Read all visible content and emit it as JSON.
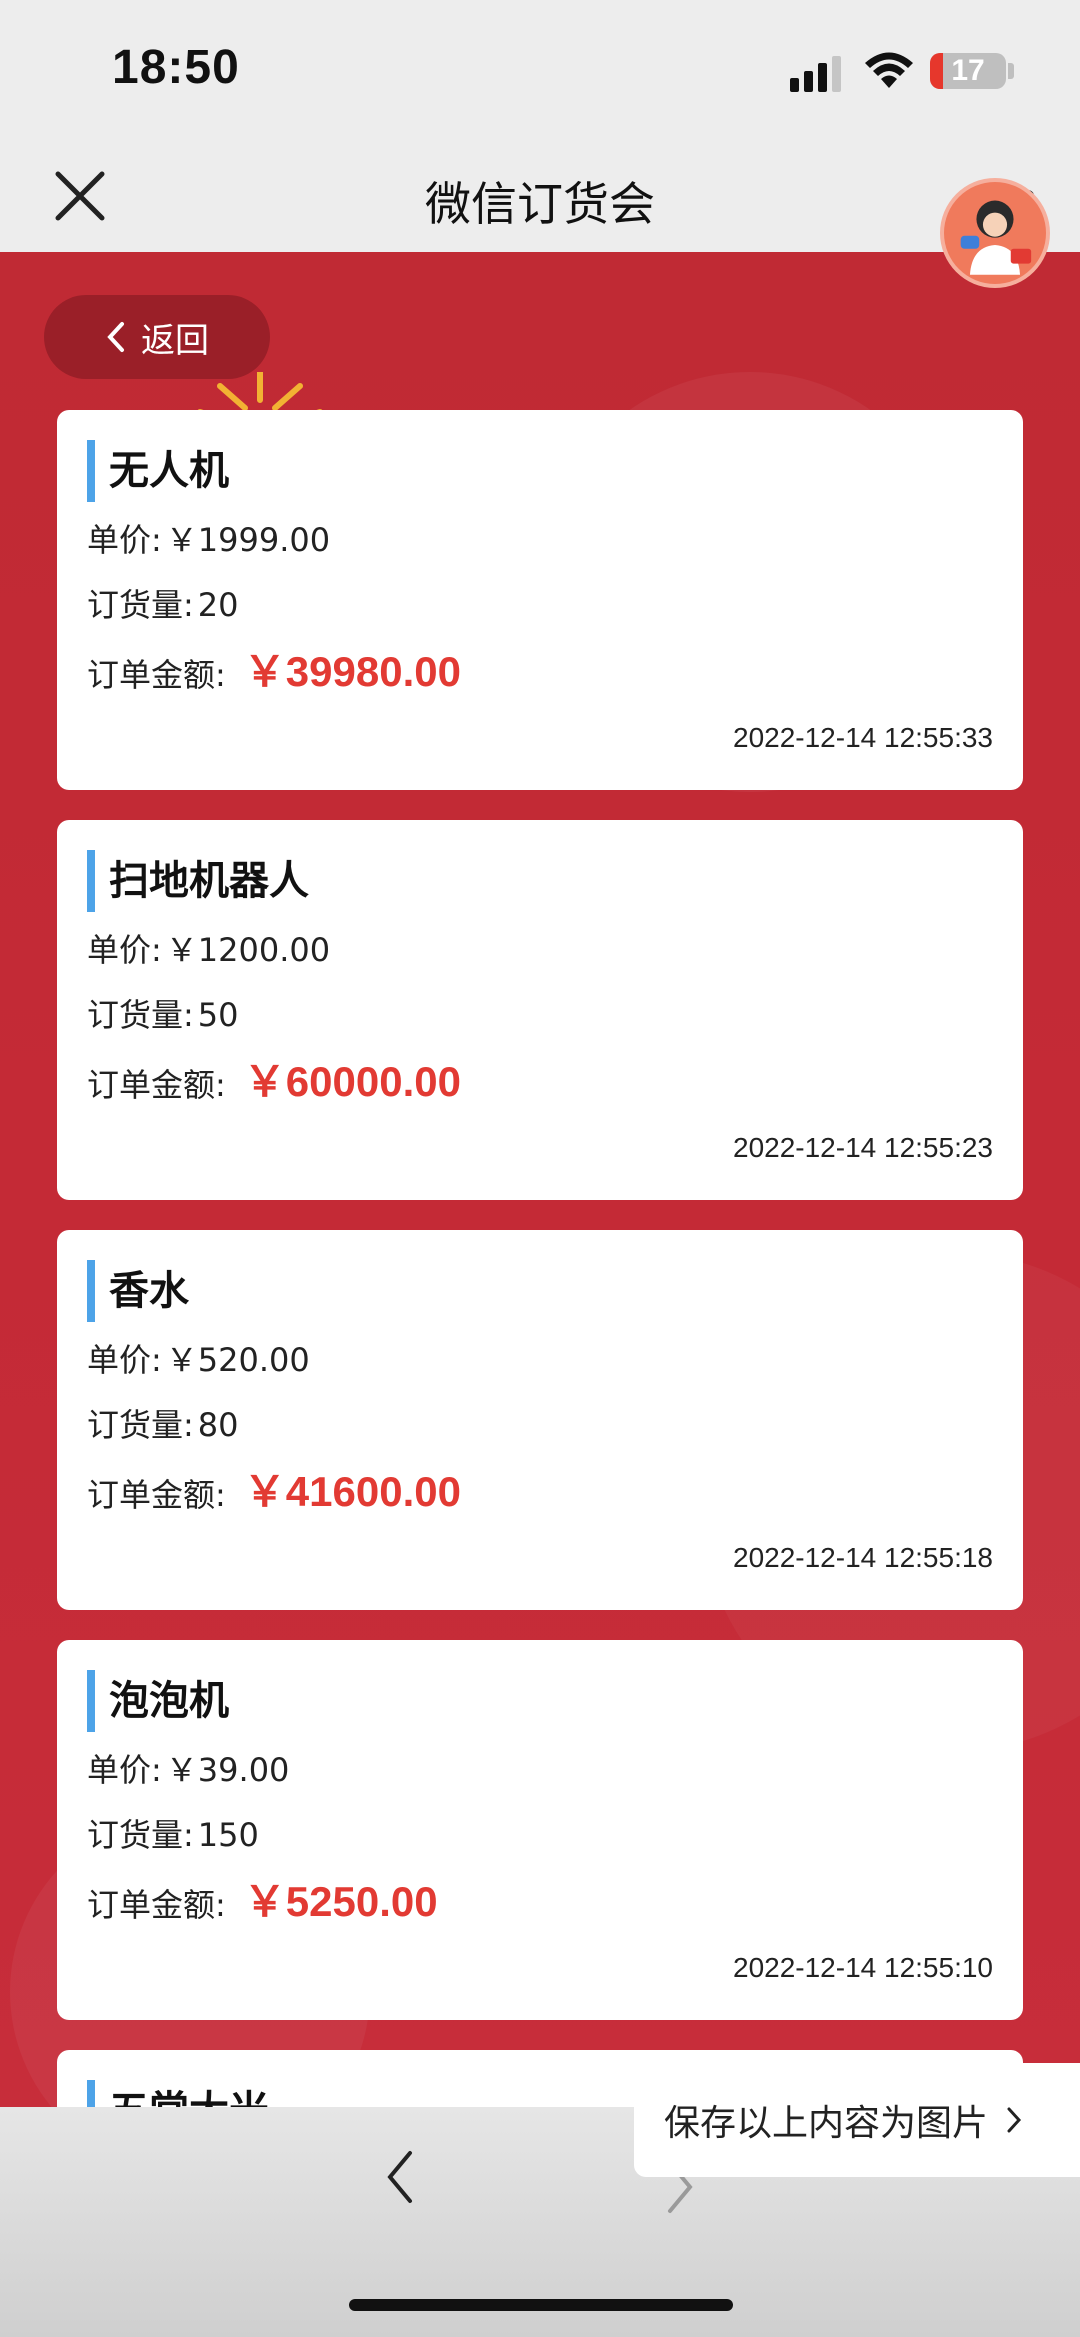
{
  "status_bar": {
    "time": "18:50",
    "battery_level": "17",
    "battery_fraction": 0.17,
    "icons": [
      "signal-icon",
      "wifi-icon",
      "battery-icon"
    ]
  },
  "nav": {
    "title": "微信订货会",
    "icons": [
      "close-icon",
      "more-icon"
    ]
  },
  "back_button": {
    "label": "返回"
  },
  "labels": {
    "unit_price": "单价:",
    "quantity": "订货量:",
    "order_amount": "订单金额:"
  },
  "orders": [
    {
      "name": "无人机",
      "unit_price": "￥1999.00",
      "quantity": "20",
      "amount": "￥39980.00",
      "time": "2022-12-14 12:55:33"
    },
    {
      "name": "扫地机器人",
      "unit_price": "￥1200.00",
      "quantity": "50",
      "amount": "￥60000.00",
      "time": "2022-12-14 12:55:23"
    },
    {
      "name": "香水",
      "unit_price": "￥520.00",
      "quantity": "80",
      "amount": "￥41600.00",
      "time": "2022-12-14 12:55:18"
    },
    {
      "name": "泡泡机",
      "unit_price": "￥39.00",
      "quantity": "150",
      "amount": "￥5250.00",
      "time": "2022-12-14 12:55:10"
    },
    {
      "name": "五常大米"
    }
  ],
  "save_popup": {
    "label": "保存以上内容为图片"
  },
  "colors": {
    "background_red": "#c42a36",
    "amount_red": "#e23a33",
    "title_accent_blue": "#4da3e8",
    "back_button_bg": "#9a1f28"
  }
}
